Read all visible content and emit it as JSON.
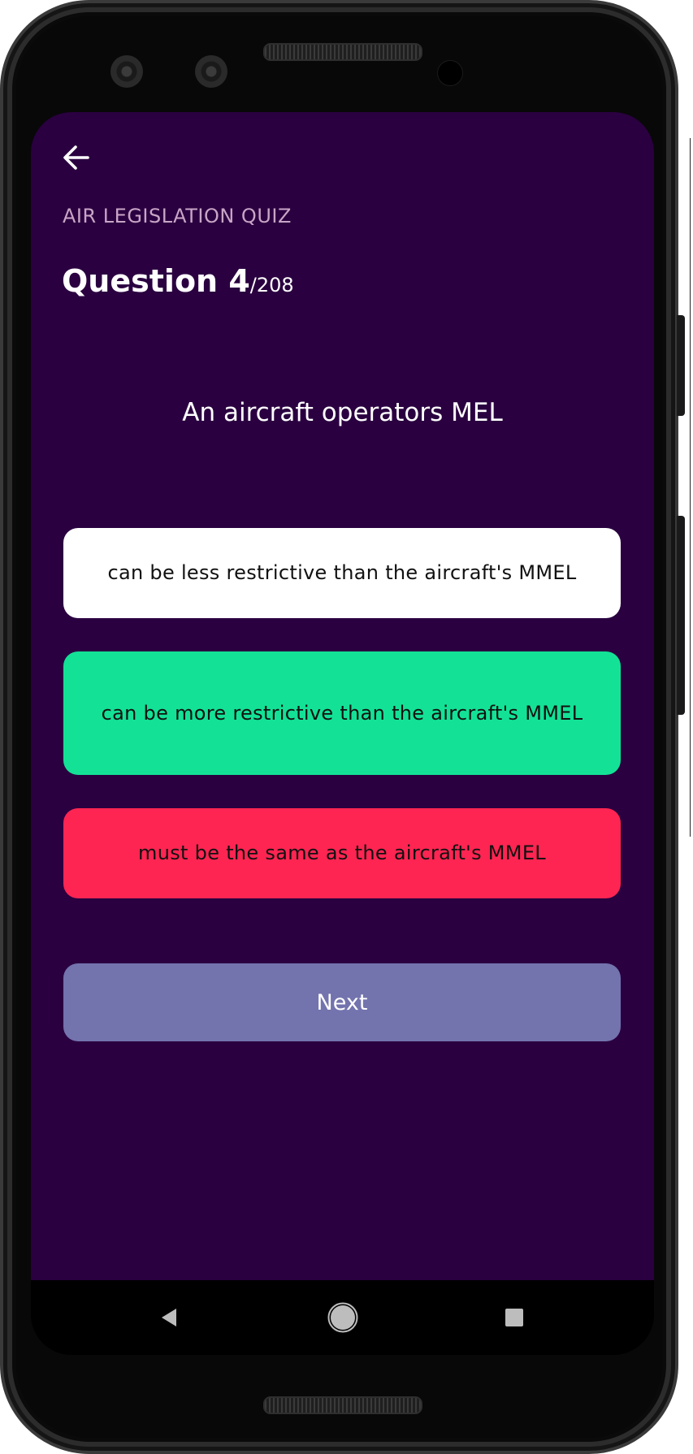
{
  "header": {
    "back_icon": "arrow-left-icon",
    "quiz_title": "AIR LEGISLATION QUIZ",
    "question_label": "Question 4",
    "question_total": "/208"
  },
  "question": {
    "text": "An aircraft operators MEL"
  },
  "answers": [
    {
      "label": "can be less restrictive than the aircraft's MMEL",
      "state": "neutral",
      "color": "#ffffff"
    },
    {
      "label": "can be more restrictive than the aircraft's MMEL",
      "state": "correct",
      "color": "#13e296"
    },
    {
      "label": "must be the same as the aircraft's MMEL",
      "state": "wrong",
      "color": "#fe2552"
    }
  ],
  "next_button": {
    "label": "Next",
    "color": "#7373ae"
  },
  "theme": {
    "background": "#2a0040",
    "accent_label": "#c9a5c6"
  },
  "system_nav": {
    "back_icon": "nav-back-triangle-icon",
    "home_icon": "nav-home-circle-icon",
    "recents_icon": "nav-recents-square-icon"
  }
}
